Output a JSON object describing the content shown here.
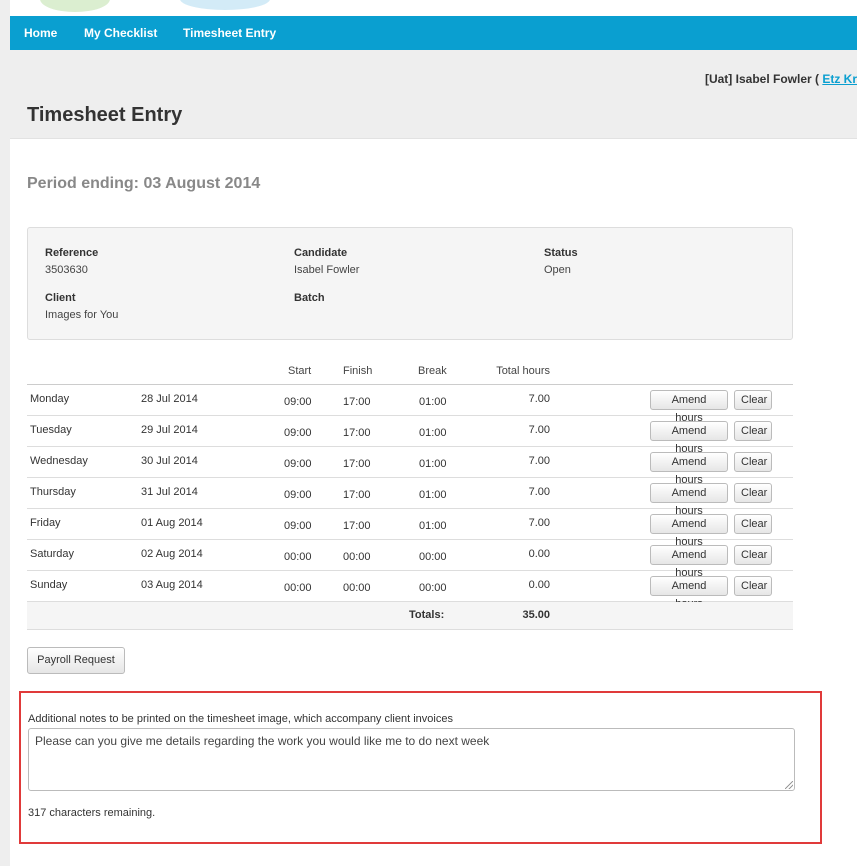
{
  "nav": {
    "items": [
      "Home",
      "My Checklist",
      "Timesheet Entry"
    ]
  },
  "user": {
    "prefix": "[Uat] Isabel Fowler ( ",
    "link": "Etz Kr"
  },
  "page": {
    "title": "Timesheet Entry",
    "period": "Period ending: 03 August 2014"
  },
  "info": {
    "reference_label": "Reference",
    "reference": "3503630",
    "candidate_label": "Candidate",
    "candidate": "Isabel Fowler",
    "status_label": "Status",
    "status": "Open",
    "client_label": "Client",
    "client": "Images for You",
    "batch_label": "Batch"
  },
  "table": {
    "headers": {
      "start": "Start",
      "finish": "Finish",
      "break": "Break",
      "total": "Total hours"
    },
    "rows": [
      {
        "day": "Monday",
        "date": "28 Jul 2014",
        "start": "09:00",
        "finish": "17:00",
        "break": "01:00",
        "total": "7.00"
      },
      {
        "day": "Tuesday",
        "date": "29 Jul 2014",
        "start": "09:00",
        "finish": "17:00",
        "break": "01:00",
        "total": "7.00"
      },
      {
        "day": "Wednesday",
        "date": "30 Jul 2014",
        "start": "09:00",
        "finish": "17:00",
        "break": "01:00",
        "total": "7.00"
      },
      {
        "day": "Thursday",
        "date": "31 Jul 2014",
        "start": "09:00",
        "finish": "17:00",
        "break": "01:00",
        "total": "7.00"
      },
      {
        "day": "Friday",
        "date": "01 Aug 2014",
        "start": "09:00",
        "finish": "17:00",
        "break": "01:00",
        "total": "7.00"
      },
      {
        "day": "Saturday",
        "date": "02 Aug 2014",
        "start": "00:00",
        "finish": "00:00",
        "break": "00:00",
        "total": "0.00"
      },
      {
        "day": "Sunday",
        "date": "03 Aug 2014",
        "start": "00:00",
        "finish": "00:00",
        "break": "00:00",
        "total": "0.00"
      }
    ],
    "amend_label": "Amend hours",
    "clear_label": "Clear",
    "totals_label": "Totals:",
    "totals_value": "35.00"
  },
  "payroll_label": "Payroll Request",
  "notes": {
    "label": "Additional notes to be printed on the timesheet image, which accompany client invoices",
    "value": "Please can you give me details regarding the work you would like me to do next week",
    "remaining": "317 characters remaining."
  },
  "colors": {
    "nav": "#0a9fd0",
    "highlight": "#e03a3a",
    "link": "#0a9fd0"
  }
}
